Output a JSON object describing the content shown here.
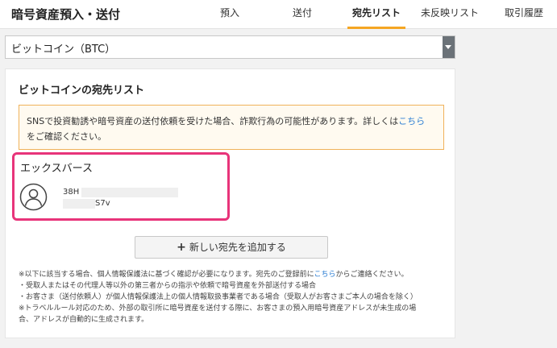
{
  "header": {
    "title": "暗号資産預入・送付",
    "tabs": [
      {
        "label": "預入",
        "active": false
      },
      {
        "label": "送付",
        "active": false
      },
      {
        "label": "宛先リスト",
        "active": true
      },
      {
        "label": "未反映リスト",
        "active": false
      },
      {
        "label": "取引履歴",
        "active": false
      }
    ]
  },
  "currency_select": {
    "value": "ビットコイン（BTC）"
  },
  "card": {
    "title": "ビットコインの宛先リスト",
    "warning": {
      "text": "SNSで投資勧誘や暗号資産の送付依頼を受けた場合、詐欺行為の可能性があります。詳しくは",
      "link": "こちら",
      "text2": "をご確認ください。"
    },
    "address": {
      "name": "エックスバース",
      "line1": "38H",
      "line2": "S7v",
      "icon": "user-avatar-icon"
    },
    "add_button": {
      "icon": "plus-icon",
      "label": "新しい宛先を追加する"
    },
    "notes": {
      "line1_pre": "※以下に該当する場合、個人情報保護法に基づく確認が必要になります。宛先のご登録前に",
      "line1_link": "こちら",
      "line1_post": "からご連絡ください。",
      "line2": "・受取人またはその代理人等以外の第三者からの指示や依頼で暗号資産を外部送付する場合",
      "line3": "・お客さま（送付依頼人）が個人情報保護法上の個人情報取扱事業者である場合（受取人がお客さまご本人の場合を除く）",
      "line4": "※トラベルルール対応のため、外部の取引所に暗号資産を送付する際に、お客さまの預入用暗号資産アドレスが未生成の場",
      "line5": "合、アドレスが自動的に生成されます。"
    }
  },
  "colors": {
    "accent": "#f5a623",
    "highlight": "#e8347a",
    "link": "#2e7fd3",
    "warning_border": "#f0b25a"
  }
}
